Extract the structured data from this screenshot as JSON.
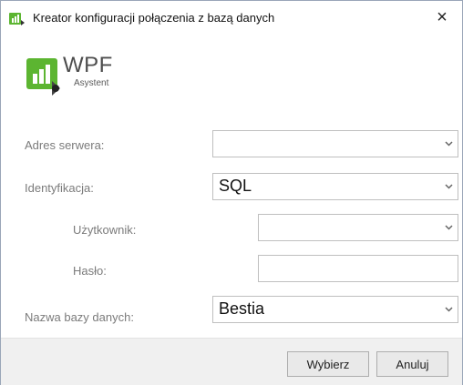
{
  "window": {
    "title": "Kreator konfiguracji połączenia z bazą danych",
    "close_label": "×"
  },
  "logo": {
    "brand": "WPF",
    "sub": "Asystent",
    "accent_color": "#5cb531"
  },
  "form": {
    "server_label": "Adres serwera:",
    "server_value": "",
    "auth_label": "Identyfikacja:",
    "auth_value": "SQL",
    "user_label": "Użytkownik:",
    "user_value": "",
    "password_label": "Hasło:",
    "password_value": "",
    "database_label": "Nazwa bazy danych:",
    "database_value": "Bestia"
  },
  "buttons": {
    "select_label": "Wybierz",
    "cancel_label": "Anuluj"
  },
  "icons": {
    "dropdown": "chevron-down-icon",
    "app": "database-connect-icon",
    "close": "close-icon"
  }
}
